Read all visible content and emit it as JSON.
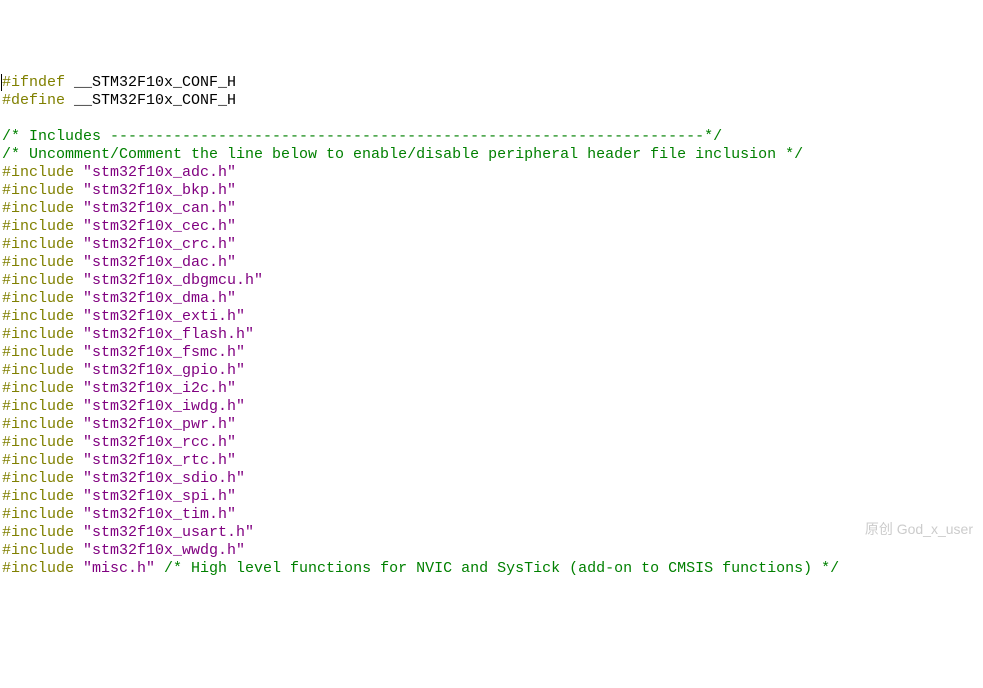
{
  "lines": [
    {
      "segments": [
        {
          "cls": "cursor-bar",
          "text": ""
        },
        {
          "cls": "kw",
          "text": "#ifndef"
        },
        {
          "cls": "ident",
          "text": " __STM32F10x_CONF_H"
        }
      ]
    },
    {
      "segments": [
        {
          "cls": "kw",
          "text": "#define"
        },
        {
          "cls": "ident",
          "text": " __STM32F10x_CONF_H"
        }
      ]
    },
    {
      "segments": [
        {
          "cls": "",
          "text": " "
        }
      ]
    },
    {
      "segments": [
        {
          "cls": "comment",
          "text": "/* Includes ------------------------------------------------------------------*/"
        }
      ]
    },
    {
      "segments": [
        {
          "cls": "comment",
          "text": "/* Uncomment/Comment the line below to enable/disable peripheral header file inclusion */"
        }
      ]
    },
    {
      "segments": [
        {
          "cls": "kw",
          "text": "#include"
        },
        {
          "cls": "str",
          "text": " \"stm32f10x_adc.h\""
        }
      ]
    },
    {
      "segments": [
        {
          "cls": "kw",
          "text": "#include"
        },
        {
          "cls": "str",
          "text": " \"stm32f10x_bkp.h\""
        }
      ]
    },
    {
      "segments": [
        {
          "cls": "kw",
          "text": "#include"
        },
        {
          "cls": "str",
          "text": " \"stm32f10x_can.h\""
        }
      ]
    },
    {
      "segments": [
        {
          "cls": "kw",
          "text": "#include"
        },
        {
          "cls": "str",
          "text": " \"stm32f10x_cec.h\""
        }
      ]
    },
    {
      "segments": [
        {
          "cls": "kw",
          "text": "#include"
        },
        {
          "cls": "str",
          "text": " \"stm32f10x_crc.h\""
        }
      ]
    },
    {
      "segments": [
        {
          "cls": "kw",
          "text": "#include"
        },
        {
          "cls": "str",
          "text": " \"stm32f10x_dac.h\""
        }
      ]
    },
    {
      "segments": [
        {
          "cls": "kw",
          "text": "#include"
        },
        {
          "cls": "str",
          "text": " \"stm32f10x_dbgmcu.h\""
        }
      ]
    },
    {
      "segments": [
        {
          "cls": "kw",
          "text": "#include"
        },
        {
          "cls": "str",
          "text": " \"stm32f10x_dma.h\""
        }
      ]
    },
    {
      "segments": [
        {
          "cls": "kw",
          "text": "#include"
        },
        {
          "cls": "str",
          "text": " \"stm32f10x_exti.h\""
        }
      ]
    },
    {
      "segments": [
        {
          "cls": "kw",
          "text": "#include"
        },
        {
          "cls": "str",
          "text": " \"stm32f10x_flash.h\""
        }
      ]
    },
    {
      "segments": [
        {
          "cls": "kw",
          "text": "#include"
        },
        {
          "cls": "str",
          "text": " \"stm32f10x_fsmc.h\""
        }
      ]
    },
    {
      "segments": [
        {
          "cls": "kw",
          "text": "#include"
        },
        {
          "cls": "str",
          "text": " \"stm32f10x_gpio.h\""
        }
      ]
    },
    {
      "segments": [
        {
          "cls": "kw",
          "text": "#include"
        },
        {
          "cls": "str",
          "text": " \"stm32f10x_i2c.h\""
        }
      ]
    },
    {
      "segments": [
        {
          "cls": "kw",
          "text": "#include"
        },
        {
          "cls": "str",
          "text": " \"stm32f10x_iwdg.h\""
        }
      ]
    },
    {
      "segments": [
        {
          "cls": "kw",
          "text": "#include"
        },
        {
          "cls": "str",
          "text": " \"stm32f10x_pwr.h\""
        }
      ]
    },
    {
      "segments": [
        {
          "cls": "kw",
          "text": "#include"
        },
        {
          "cls": "str",
          "text": " \"stm32f10x_rcc.h\""
        }
      ]
    },
    {
      "segments": [
        {
          "cls": "kw",
          "text": "#include"
        },
        {
          "cls": "str",
          "text": " \"stm32f10x_rtc.h\""
        }
      ]
    },
    {
      "segments": [
        {
          "cls": "kw",
          "text": "#include"
        },
        {
          "cls": "str",
          "text": " \"stm32f10x_sdio.h\""
        }
      ]
    },
    {
      "segments": [
        {
          "cls": "kw",
          "text": "#include"
        },
        {
          "cls": "str",
          "text": " \"stm32f10x_spi.h\""
        }
      ]
    },
    {
      "segments": [
        {
          "cls": "kw",
          "text": "#include"
        },
        {
          "cls": "str",
          "text": " \"stm32f10x_tim.h\""
        }
      ]
    },
    {
      "segments": [
        {
          "cls": "kw",
          "text": "#include"
        },
        {
          "cls": "str",
          "text": " \"stm32f10x_usart.h\""
        }
      ]
    },
    {
      "segments": [
        {
          "cls": "kw",
          "text": "#include"
        },
        {
          "cls": "str",
          "text": " \"stm32f10x_wwdg.h\""
        }
      ]
    },
    {
      "segments": [
        {
          "cls": "kw",
          "text": "#include"
        },
        {
          "cls": "str",
          "text": " \"misc.h\""
        },
        {
          "cls": "comment",
          "text": " /* High level functions for NVIC and SysTick (add-on to CMSIS functions) */"
        }
      ]
    }
  ],
  "watermark": "原创 God_x_user"
}
